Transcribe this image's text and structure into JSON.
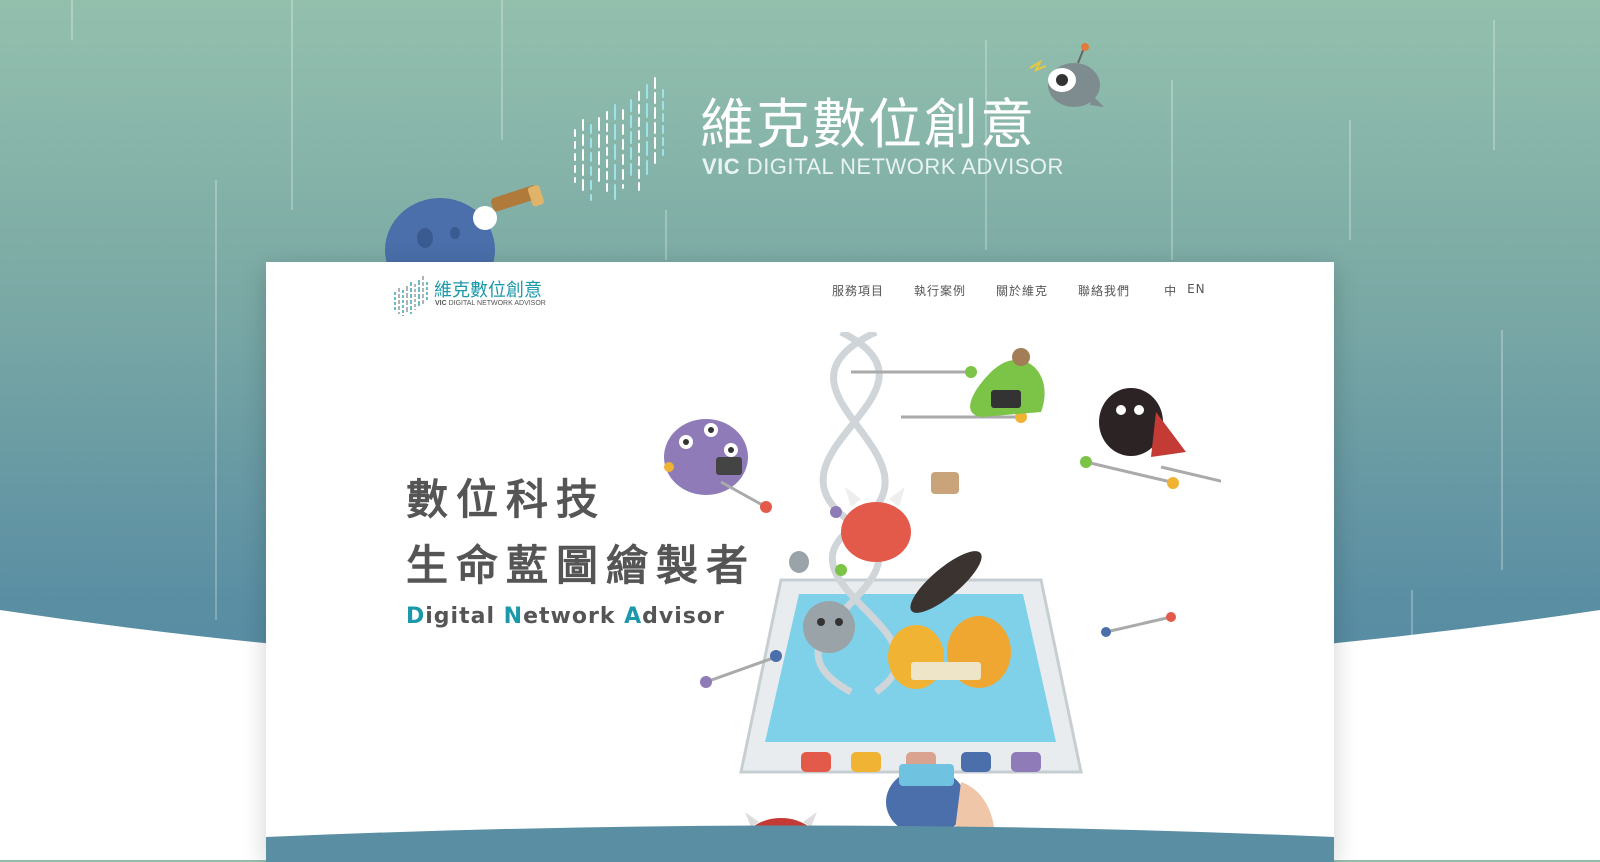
{
  "brand": {
    "name_cn": "維克數位創意",
    "name_en_bold": "VIC",
    "name_en_rest": " DIGITAL NETWORK ADVISOR"
  },
  "nav": {
    "items": [
      {
        "label": "服務項目"
      },
      {
        "label": "執行案例"
      },
      {
        "label": "關於維克"
      },
      {
        "label": "聯絡我們"
      }
    ],
    "lang_zh": "中",
    "lang_en": "EN"
  },
  "hero": {
    "line1": "數位科技",
    "line2": "生命藍圖繪製者",
    "sub": {
      "d": "D",
      "d_rest": "igital ",
      "n": "N",
      "n_rest": "etwork ",
      "a": "A",
      "a_rest": "dvisor"
    }
  },
  "colors": {
    "accent": "#1b98a9",
    "text": "#555555",
    "bg_top": "#93c0ad",
    "bg_bottom": "#4f86a0"
  },
  "icons": {
    "logo_mark": "sound-bars-icon",
    "robot": "robot-mascot-icon",
    "monster_telescope": "telescope-monster-icon"
  }
}
